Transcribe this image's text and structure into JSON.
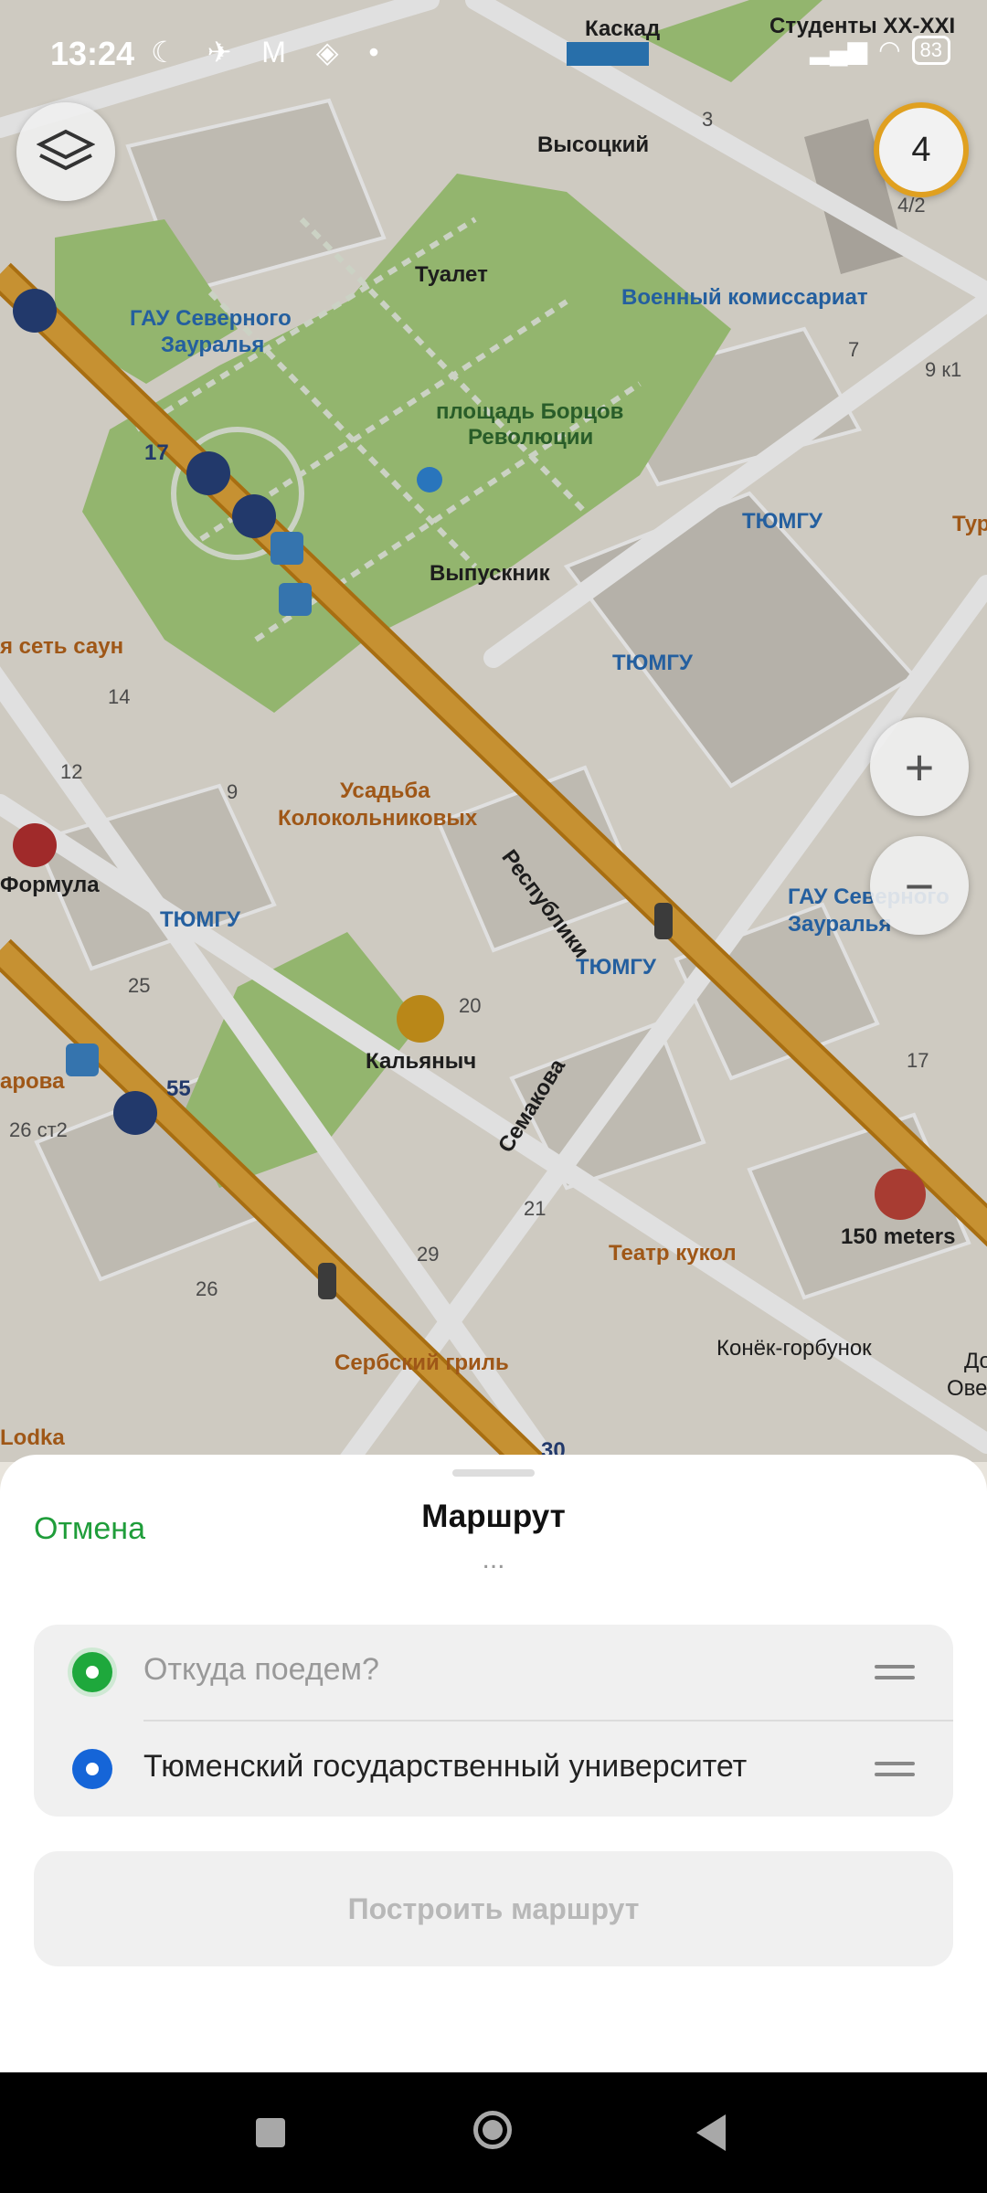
{
  "status_bar": {
    "time": "13:24",
    "icons": "☾ ✈ M ◈ •",
    "signal": "▂▄▆",
    "battery": "83"
  },
  "map": {
    "badge_count": "4",
    "zoom_in": "+",
    "zoom_out": "−",
    "labels": {
      "kaskad": "Каскад",
      "studenty": "Студенты XX-XXI",
      "visotsky": "Высоцкий",
      "n3": "3",
      "n472": "4/2",
      "gau1": "ГАУ Северного",
      "gau1b": "Зауралья",
      "tualet": "Туалет",
      "voenkomat": "Военный комиссариат",
      "n7": "7",
      "n9k1": "9 к1",
      "ploshad1": "площадь Борцов",
      "ploshad2": "Революции",
      "tyumgu1": "ТЮМГУ",
      "tur": "Тур",
      "vypusknik": "Выпускник",
      "tyumgu2": "ТЮМГУ",
      "sauny": "я сеть саун",
      "n14": "14",
      "n12": "12",
      "n9": "9",
      "usadba1": "Усадьба",
      "usadba2": "Колокольниковых",
      "respubliki": "Республики",
      "formula": "Формула",
      "tyumgu3": "ТЮМГУ",
      "gau2": "ГАУ Северного",
      "gau2b": "Зауралья",
      "tyumgu4": "ТЮМГУ",
      "n25": "25",
      "n20": "20",
      "kalyanych": "Кальяныч",
      "semakova": "Семакова",
      "arova": "арова",
      "n55": "55",
      "n17": "17",
      "n26st2": "26 ст2",
      "n17b": "17",
      "n21": "21",
      "meters": "150 meters",
      "n29": "29",
      "teatr": "Театр кукол",
      "n26": "26",
      "konek": "Конёк-горбунок",
      "serbsky": "Сербский гриль",
      "lodka": "Lodka",
      "n30": "30",
      "do": "До",
      "ove": "Ове"
    }
  },
  "sheet": {
    "cancel": "Отмена",
    "title": "Маршрут",
    "dots": "...",
    "from_placeholder": "Откуда поедем?",
    "to_value": "Тюменский государственный университет",
    "build_button": "Построить маршрут"
  },
  "colors": {
    "accent_green": "#1ea83c",
    "accent_blue": "#1565d8",
    "main_road": "#d99a2b",
    "park": "#a8cf7e"
  }
}
